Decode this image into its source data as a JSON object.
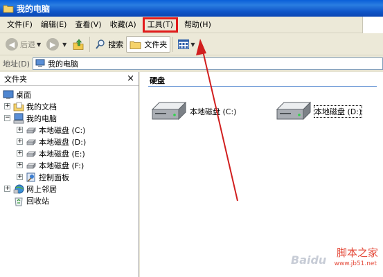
{
  "window": {
    "title": "我的电脑"
  },
  "menu": {
    "items": [
      {
        "label": "文件(F)"
      },
      {
        "label": "编辑(E)"
      },
      {
        "label": "查看(V)"
      },
      {
        "label": "收藏(A)"
      },
      {
        "label": "工具(T)",
        "highlighted": true
      },
      {
        "label": "帮助(H)"
      }
    ]
  },
  "toolbar": {
    "back_label": "后退",
    "search_label": "搜索",
    "folders_label": "文件夹"
  },
  "address": {
    "label": "地址(D)",
    "value": "我的电脑"
  },
  "folder_pane": {
    "title": "文件夹",
    "close_glyph": "×",
    "tree": [
      {
        "label": "桌面",
        "expander": "",
        "icon": "desktop-icon"
      },
      {
        "label": "我的文档",
        "expander": "+",
        "icon": "my-documents-icon"
      },
      {
        "label": "我的电脑",
        "expander": "−",
        "icon": "my-computer-icon"
      },
      {
        "label": "本地磁盘 (C:)",
        "expander": "+",
        "icon": "drive-icon"
      },
      {
        "label": "本地磁盘 (D:)",
        "expander": "+",
        "icon": "drive-icon"
      },
      {
        "label": "本地磁盘 (E:)",
        "expander": "+",
        "icon": "drive-icon"
      },
      {
        "label": "本地磁盘 (F:)",
        "expander": "+",
        "icon": "drive-icon"
      },
      {
        "label": "控制面板",
        "expander": "+",
        "icon": "control-panel-icon"
      },
      {
        "label": "网上邻居",
        "expander": "+",
        "icon": "network-places-icon"
      },
      {
        "label": "回收站",
        "expander": "",
        "icon": "recycle-bin-icon"
      }
    ]
  },
  "content": {
    "group_title": "硬盘",
    "drives": [
      {
        "label": "本地磁盘 (C:)"
      },
      {
        "label": "本地磁盘 (D:)",
        "selected": true
      }
    ]
  },
  "watermark": {
    "brand": "脚本之家",
    "url": "www.jb51.net",
    "baidu": "Baidu"
  },
  "colors": {
    "title_bar": "#0a5fd8",
    "highlight_box": "#e21b1b",
    "arrow": "#d11f1f"
  }
}
